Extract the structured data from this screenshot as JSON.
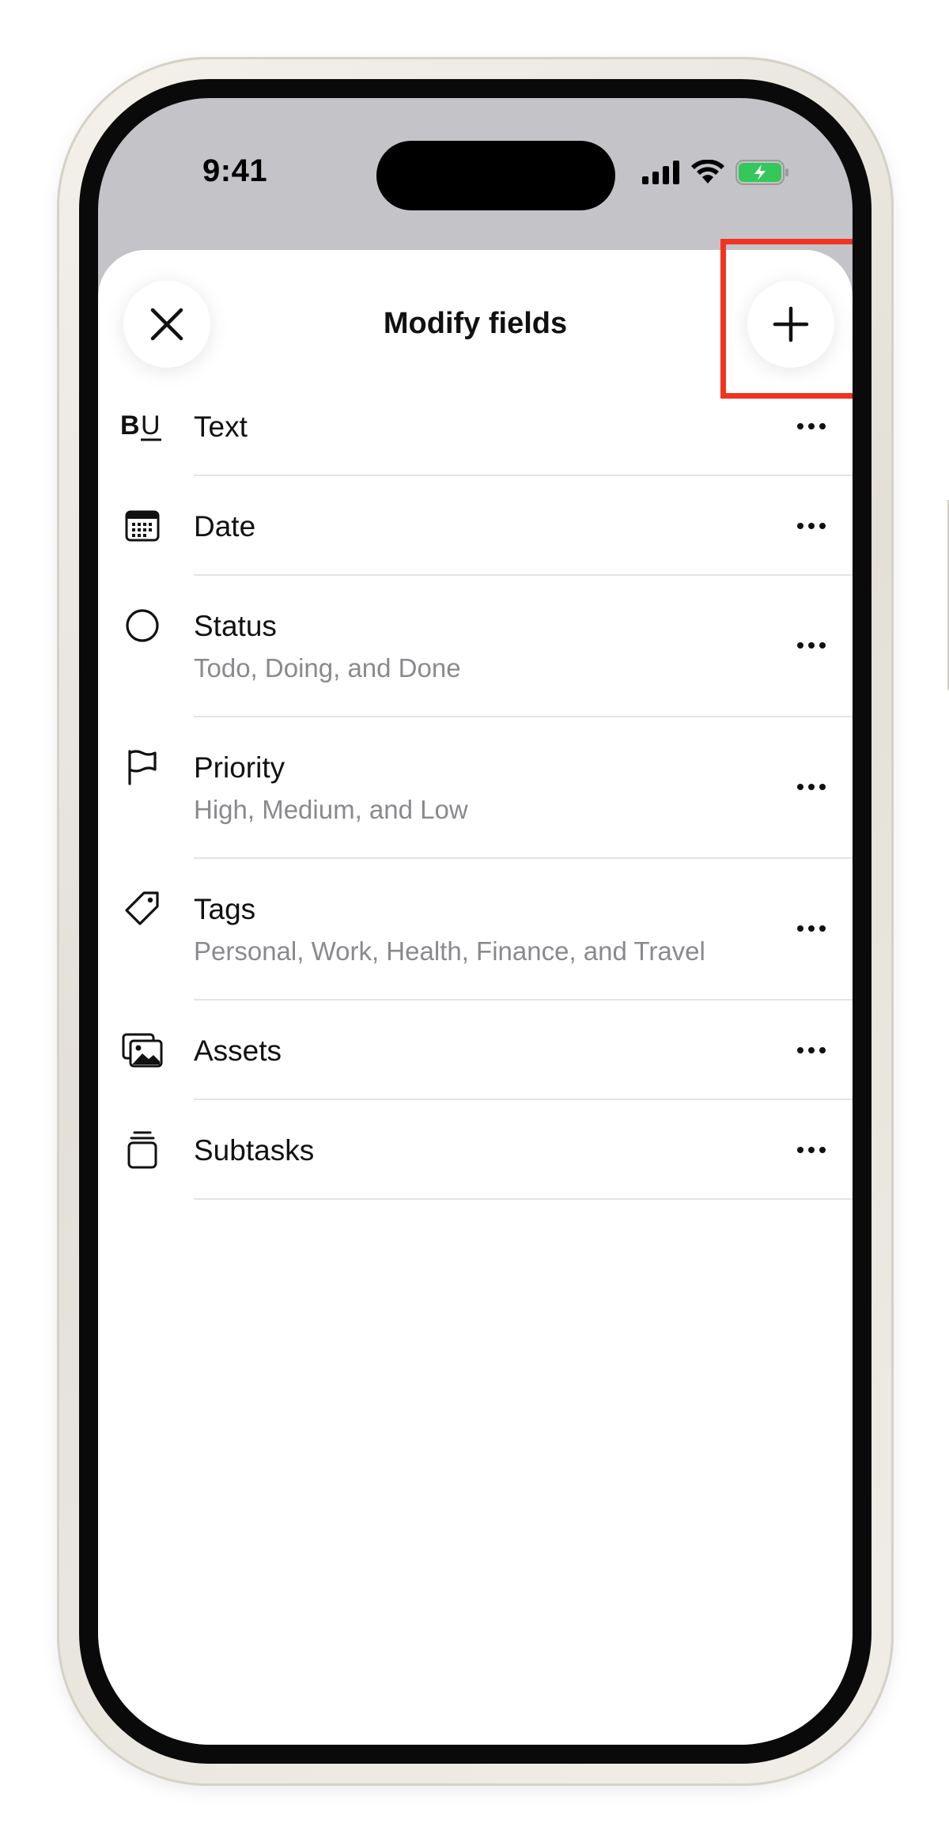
{
  "status_bar": {
    "time": "9:41",
    "icons": [
      "cellular-signal-icon",
      "wifi-icon",
      "battery-charging-icon"
    ],
    "battery_color": "#34c759"
  },
  "sheet": {
    "title": "Modify fields",
    "close_icon": "close-icon",
    "add_icon": "plus-icon",
    "highlight_color": "#f13320"
  },
  "fields": [
    {
      "label": "Text",
      "subtitle": "",
      "icon": "text-format-icon"
    },
    {
      "label": "Date",
      "subtitle": "",
      "icon": "calendar-icon"
    },
    {
      "label": "Status",
      "subtitle": "Todo, Doing, and Done",
      "icon": "circle-icon"
    },
    {
      "label": "Priority",
      "subtitle": "High, Medium, and Low",
      "icon": "flag-icon"
    },
    {
      "label": "Tags",
      "subtitle": "Personal, Work, Health, Finance, and Travel",
      "icon": "tag-icon"
    },
    {
      "label": "Assets",
      "subtitle": "",
      "icon": "images-icon"
    },
    {
      "label": "Subtasks",
      "subtitle": "",
      "icon": "stack-icon"
    }
  ],
  "row_menu_icon": "more-horizontal-icon"
}
